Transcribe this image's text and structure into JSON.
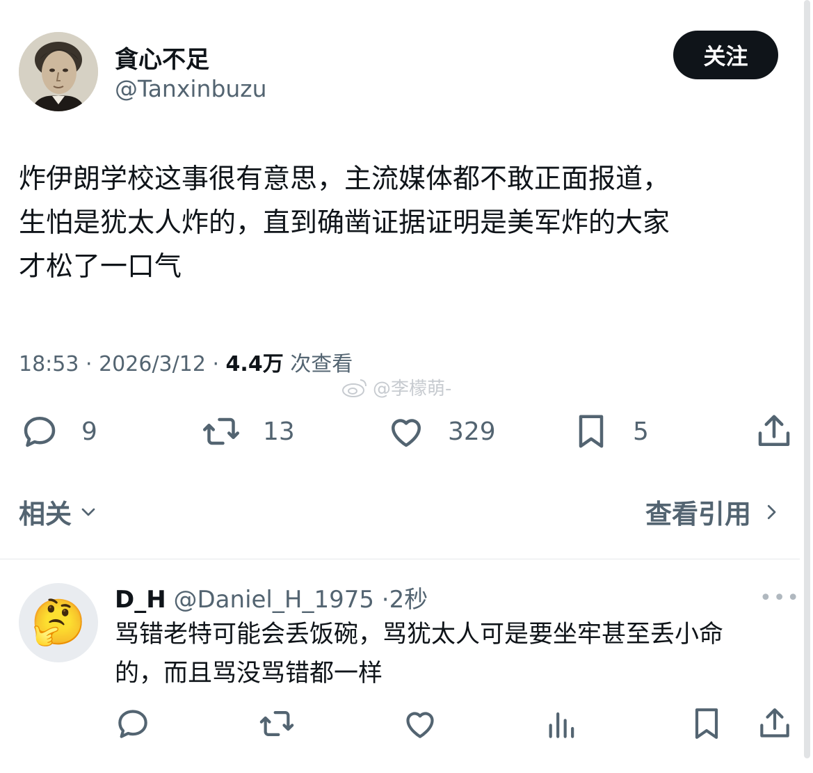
{
  "author": {
    "display_name": "貪心不足",
    "handle": "@Tanxinbuzu"
  },
  "follow_button": "关注",
  "tweet": {
    "lines": [
      "炸伊朗学校这事很有意思，主流媒体都不敢正面报道，",
      "生怕是犹太人炸的，直到确凿证据证明是美军炸的大家",
      "才松了一口气"
    ],
    "time": "18:53",
    "date": "2026/3/12",
    "views_count": "4.4万",
    "views_label": "次查看"
  },
  "watermark": "@李檬萌-",
  "actions": {
    "replies": "9",
    "reposts": "13",
    "likes": "329",
    "bookmarks": "5"
  },
  "related_label": "相关",
  "view_quotes_label": "查看引用",
  "reply": {
    "name": "D_H",
    "handle": "@Daniel_H_1975",
    "time": "2秒",
    "avatar_emoji": "🤔",
    "lines": [
      "骂错老特可能会丢饭碗，骂犹太人可是要坐牢甚至丢小命",
      "的，而且骂没骂错都一样"
    ]
  },
  "icons": {
    "reply": "reply-icon",
    "repost": "repost-icon",
    "like": "heart-icon",
    "bookmark": "bookmark-icon",
    "share": "share-icon",
    "views": "views-icon",
    "more": "more-icon"
  },
  "colors": {
    "text_primary": "#0f1419",
    "text_secondary": "#536471",
    "follow_bg": "#0f1419"
  }
}
